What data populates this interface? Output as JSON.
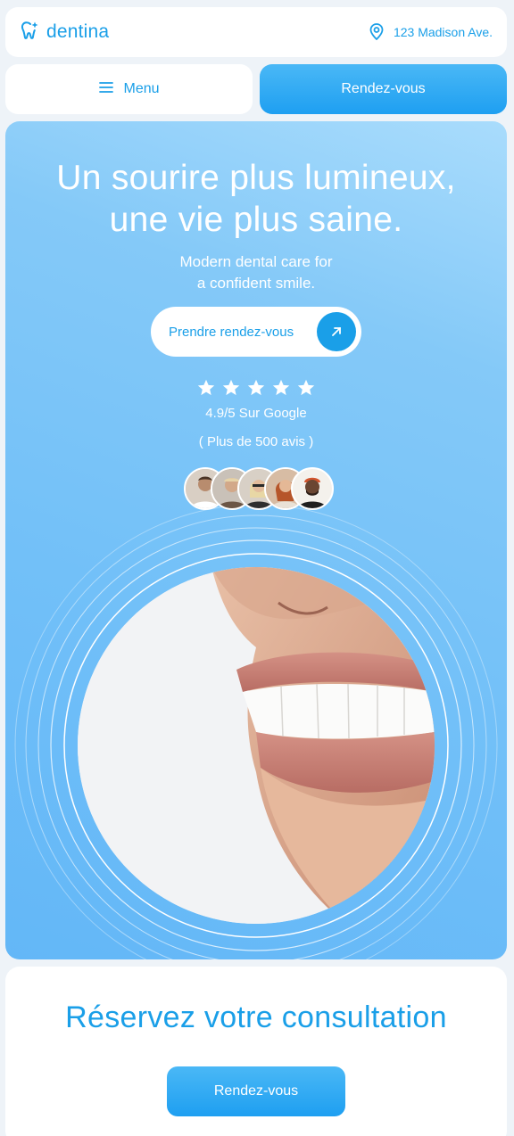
{
  "header": {
    "brand": "dentina",
    "address": "123 Madison Ave."
  },
  "nav": {
    "menu_label": "Menu",
    "appointment_label": "Rendez-vous"
  },
  "hero": {
    "title_line1": "Un sourire plus lumineux,",
    "title_line2": "une vie plus saine.",
    "subtitle_line1": "Modern dental care for",
    "subtitle_line2": "a confident smile.",
    "cta_label": "Prendre rendez-vous",
    "stars": 5,
    "rating": "4.9/5 Sur Google",
    "reviews": "( Plus de 500 avis )"
  },
  "booking": {
    "title": "Réservez votre consultation",
    "button_label": "Rendez-vous"
  },
  "colors": {
    "accent": "#1a9fe8",
    "hero_gradient": "#84c9f8"
  }
}
